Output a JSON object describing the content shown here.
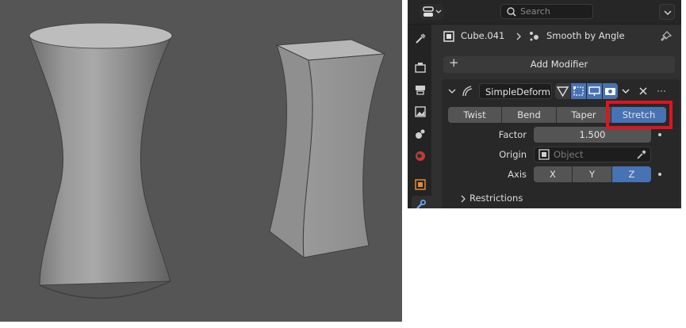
{
  "search": {
    "placeholder": "Search"
  },
  "breadcrumb": {
    "object": "Cube.041",
    "modifier": "Smooth by Angle"
  },
  "add_modifier": {
    "label": "Add Modifier"
  },
  "modifier": {
    "name": "SimpleDeform",
    "modes": [
      "Twist",
      "Bend",
      "Taper",
      "Stretch"
    ],
    "active_mode": "Stretch",
    "factor_label": "Factor",
    "factor_value": "1.500",
    "origin_label": "Origin",
    "origin_placeholder": "Object",
    "axis_label": "Axis",
    "axes": [
      "X",
      "Y",
      "Z"
    ],
    "active_axis": "Z",
    "restrictions_label": "Restrictions"
  },
  "colors": {
    "accent": "#4772b3",
    "highlight": "#e0141e"
  }
}
